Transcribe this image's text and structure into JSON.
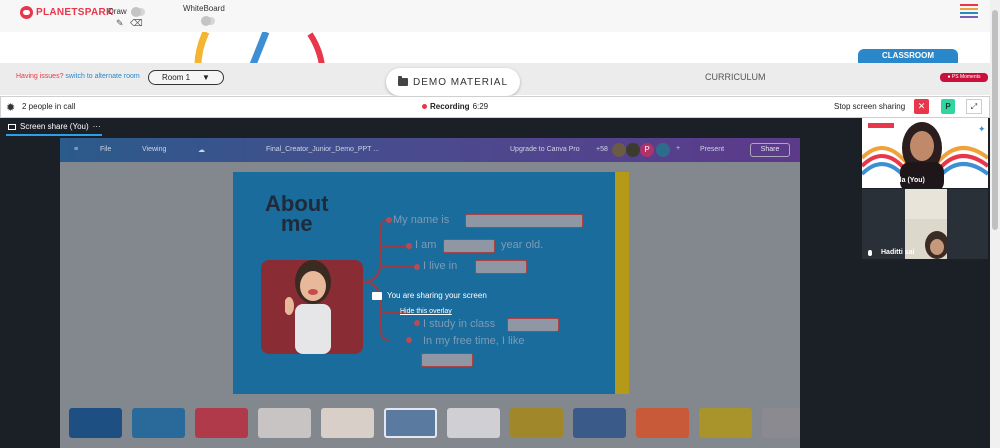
{
  "brand": {
    "name": "PLANETSPARK",
    "color": "#e8374b"
  },
  "toolbar": {
    "draw_label": "Draw",
    "whiteboard_label": "WhiteBoard",
    "pencil_icon": "pencil-icon",
    "eraser_icon": "eraser-icon"
  },
  "nav": {
    "issues_text": "Having issues?",
    "alternate_link": "switch to alternate room",
    "room_value": "Room 1",
    "demo_material": "DEMO MATERIAL",
    "curriculum": "CURRICULUM",
    "classroom": "CLASSROOM",
    "moments_badge": "PS Moments"
  },
  "call": {
    "people_count": "2 people in call",
    "recording_label": "Recording",
    "recording_time": "6:29",
    "stop_sharing": "Stop screen sharing",
    "p_badge": "P"
  },
  "stage": {
    "screen_share_tab": "Screen share (You)",
    "more": "···"
  },
  "canva": {
    "file": "File",
    "viewing": "Viewing",
    "doc_title": "Final_Creator_Junior_Demo_PPT ...",
    "upgrade": "Upgrade to Canva Pro",
    "plus_count": "+58",
    "present": "Present",
    "share": "Share",
    "slide": {
      "title_line1": "About",
      "title_line2": "me",
      "my_name": "My name is",
      "i_am": "I am",
      "years_old": "year old.",
      "i_live": "I live in",
      "i_study": "I study in class",
      "free_time": "In my free time, I like"
    }
  },
  "overlay": {
    "sharing": "You are sharing your screen",
    "hide": "Hide this overlay"
  },
  "participants": [
    {
      "name": "Shakila (You)"
    },
    {
      "name": "Haditti sai"
    }
  ],
  "accent_colors": {
    "blue": "#2a87c9",
    "red": "#e8374b",
    "green": "#2fd6a2"
  }
}
